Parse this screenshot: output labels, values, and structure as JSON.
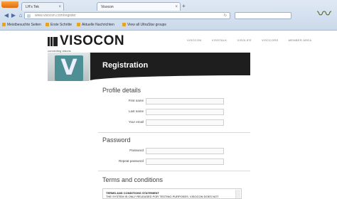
{
  "browser": {
    "tabs": [
      {
        "label": "LH's Tek",
        "active": false
      },
      {
        "label": "Visocon",
        "active": true
      }
    ],
    "new_tab_symbol": "+",
    "url_text": "www.visocon.com/register",
    "search_placeholder": "",
    "bookmarks": [
      "Meistbesuchte Seiten",
      "Erste Schritte",
      "Aktuelle Nachrichten",
      "View all UltraStar groups"
    ]
  },
  "site": {
    "logo_text": "VISOCON",
    "tagline": "connecting visions",
    "nav": [
      "VISOCON",
      "VISOTALK",
      "VISOLIFE",
      "VISOCORE",
      "MEMBER AREA"
    ],
    "banner_letter": "V",
    "banner_title": "Registration"
  },
  "form": {
    "profile_title": "Profile details",
    "first_name_label": "First name",
    "last_name_label": "Last name",
    "email_label": "Your email",
    "password_title": "Password",
    "password_label": "Password",
    "repeat_password_label": "Repeat password",
    "terms_title": "Terms and conditions",
    "terms_heading": "TERMS AND CONDITIONS STATEMENT",
    "terms_text": "THE SYSTEM IS ONLY RELEASED FOR TESTING PURPOSES. VISOCON DOES NOT"
  },
  "colors": {
    "banner_dark": "#1e1e1e",
    "logo_teal": "#4e8f96"
  }
}
